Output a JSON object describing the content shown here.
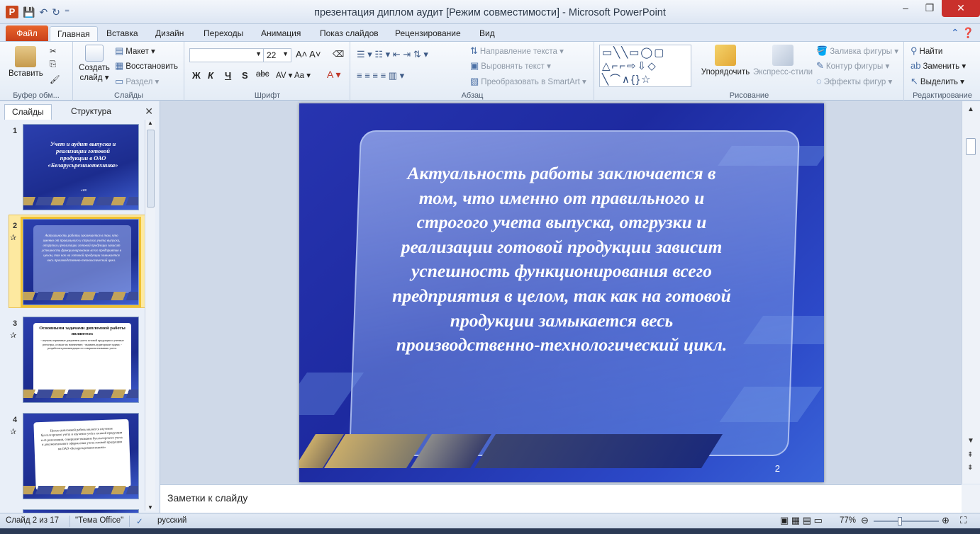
{
  "window": {
    "title": "презентация диплом аудит [Режим совместимости]  -  Microsoft PowerPoint",
    "app_icon": "P",
    "controls": {
      "minimize": "–",
      "restore": "❐",
      "close": "✕"
    }
  },
  "tabs": {
    "file": "Файл",
    "items": [
      "Главная",
      "Вставка",
      "Дизайн",
      "Переходы",
      "Анимация",
      "Показ слайдов",
      "Рецензирование",
      "Вид"
    ],
    "active": "Главная"
  },
  "ribbon": {
    "clipboard": {
      "paste": "Вставить",
      "label": "Буфер обм..."
    },
    "slides": {
      "new_slide_1": "Создать",
      "new_slide_2": "слайд ▾",
      "layout": "Макет ▾",
      "reset": "Восстановить",
      "section": "Раздел ▾",
      "label": "Слайды"
    },
    "font": {
      "size": "22",
      "bold": "Ж",
      "italic": "К",
      "underline": "Ч",
      "strike": "S",
      "spacing": "abc",
      "label": "Шрифт"
    },
    "paragraph": {
      "text_direction": "Направление текста ▾",
      "align_text": "Выровнять текст ▾",
      "smartart": "Преобразовать в SmartArt ▾",
      "label": "Абзац"
    },
    "drawing": {
      "arrange": "Упорядочить",
      "quick_styles": "Экспресс-стили",
      "fill": "Заливка фигуры ▾",
      "outline": "Контур фигуры ▾",
      "effects": "Эффекты фигур ▾",
      "label": "Рисование"
    },
    "editing": {
      "find": "Найти",
      "replace": "Заменить ▾",
      "select": "Выделить ▾",
      "label": "Редактирование"
    }
  },
  "left_pane": {
    "tab_slides": "Слайды",
    "tab_outline": "Структура",
    "close": "✕",
    "slides": [
      {
        "num": "1",
        "text": "Учет и аудит выпуска и реализации готовой продукции в ОАО «Белаpусьрезинотехника»",
        "sub": "«ек"
      },
      {
        "num": "2",
        "text": "Актуальность работы заключается в том, что именно от правильного и строгого учета выпуска, отгрузки и реализации готовой продукции зависит успешность функционирования всего предприятия в целом, так как на готовой продукции замыкается весь производственно-технологический цикл."
      },
      {
        "num": "3",
        "title": "Основными задачами дипломной работы являются:",
        "text": "- изучить первичные документы учета готовой продукции и учетные регистры, а также их назначение; - выявить аудиторские задачи; - разработать рекомендации по совершенствованию учета."
      },
      {
        "num": "4",
        "text": "Целью дипломной работы является изучение бухгалтерского учёта и изучение учёта готовой продукции и её реализации, совершенствование бухгалтерского учета и документального оформления учета готовой продукции на ОАО «Белаpусьрезинотехника»"
      }
    ]
  },
  "slide": {
    "text": "Актуальность работы заключается в том, что именно от правильного и строгого учета выпуска, отгрузки и реализации готовой продукции зависит успешность функционирования всего предприятия в целом, так как на готовой продукции замыкается весь производственно-технологический цикл.",
    "number": "2"
  },
  "notes": {
    "placeholder": "Заметки к слайду"
  },
  "status": {
    "slide": "Слайд 2 из 17",
    "theme": "\"Тема Office\"",
    "language": "русский",
    "zoom": "77%"
  },
  "colors": {
    "accent": "#2b52a6",
    "file_tab": "#d9501f",
    "slide_bg": "#2232a8",
    "selection": "#f1c232"
  }
}
